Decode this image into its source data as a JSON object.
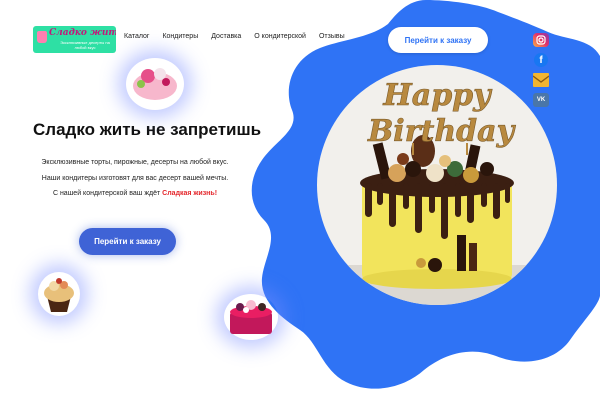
{
  "header": {
    "logo": {
      "title": "Сладко жить",
      "tagline": "Эксклюзивные десерты на любой вкус"
    },
    "nav": [
      "Каталог",
      "Кондитеры",
      "Доставка",
      "О кондитерской",
      "Отзывы"
    ],
    "cta_label": "Перейти к заказу"
  },
  "social": [
    {
      "icon": "instagram-icon"
    },
    {
      "icon": "facebook-icon",
      "glyph": "f"
    },
    {
      "icon": "mail-icon"
    },
    {
      "icon": "vk-icon",
      "glyph": "VK"
    }
  ],
  "hero": {
    "title": "Сладко жить не запретишь",
    "line1": "Эксклюзивные торты, пирожные, десерты на любой вкус.",
    "line2": "Наши кондитеры изготовят для вас десерт вашей мечты.",
    "line3_prefix": "С нашей кондитерской ваш ждёт ",
    "brand": "Сладкая жизнь!",
    "cta_label": "Перейти к заказу"
  },
  "cake_topper": "Happy Birthday",
  "colors": {
    "blob": "#2f73f5",
    "logo_bg": "#2ee0a4",
    "button": "#3f63d6",
    "brand_red": "#e4262b"
  }
}
